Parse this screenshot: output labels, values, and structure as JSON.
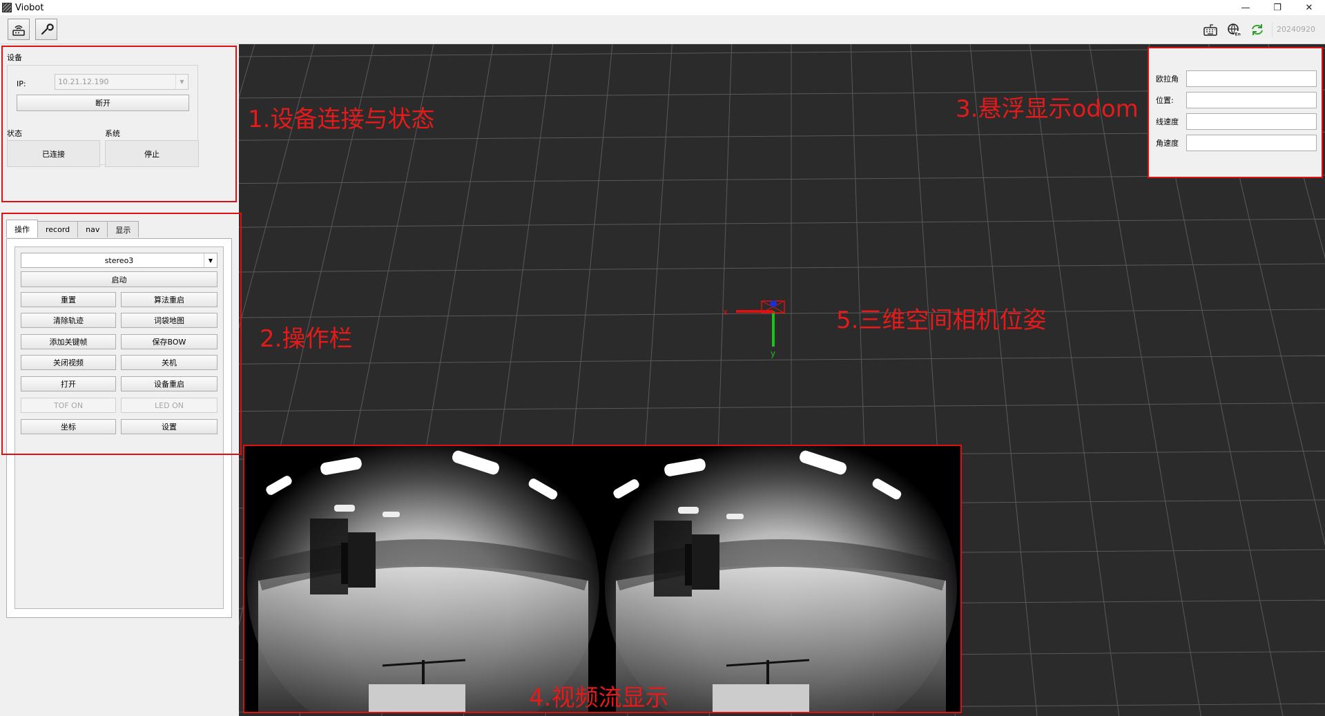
{
  "window": {
    "title": "Viobot",
    "minimize": "—",
    "restore": "❐",
    "close": "✕"
  },
  "toolbar": {
    "version": "20240920"
  },
  "device": {
    "group_title": "设备",
    "ip_label": "IP:",
    "ip_value": "10.21.12.190",
    "disconnect_label": "断开",
    "status_title": "状态",
    "system_title": "系统",
    "status_value": "已连接",
    "system_value": "停止"
  },
  "tabs": [
    "操作",
    "record",
    "nav",
    "显示"
  ],
  "ops": {
    "mode_selected": "stereo3",
    "start": "启动",
    "reset": "重置",
    "algo_restart": "算法重启",
    "clear_trajectory": "清除轨迹",
    "bow_map": "词袋地图",
    "add_keyframe": "添加关键帧",
    "save_bow": "保存BOW",
    "close_video": "关闭视频",
    "shutdown": "关机",
    "open": "打开",
    "device_restart": "设备重启",
    "tof_on": "TOF ON",
    "led_on": "LED ON",
    "coordinates": "坐标",
    "settings": "设置"
  },
  "odom": {
    "euler_label": "欧拉角",
    "position_label": "位置:",
    "linear_velocity_label": "线速度",
    "angular_velocity_label": "角速度",
    "euler_value": "",
    "position_value": "",
    "linear_velocity_value": "",
    "angular_velocity_value": ""
  },
  "axes": {
    "x_label": "x",
    "y_label": "y"
  },
  "annotations": {
    "a1": "1.设备连接与状态",
    "a2": "2.操作栏",
    "a3": "3.悬浮显示odom",
    "a4": "4.视频流显示",
    "a5": "5.三维空间相机位姿"
  },
  "colors": {
    "annotation": "#e01010",
    "view_bg": "#2b2b2b",
    "grid": "#5a5a5a",
    "axis_x": "#e01010",
    "axis_y": "#1fbf1f"
  }
}
